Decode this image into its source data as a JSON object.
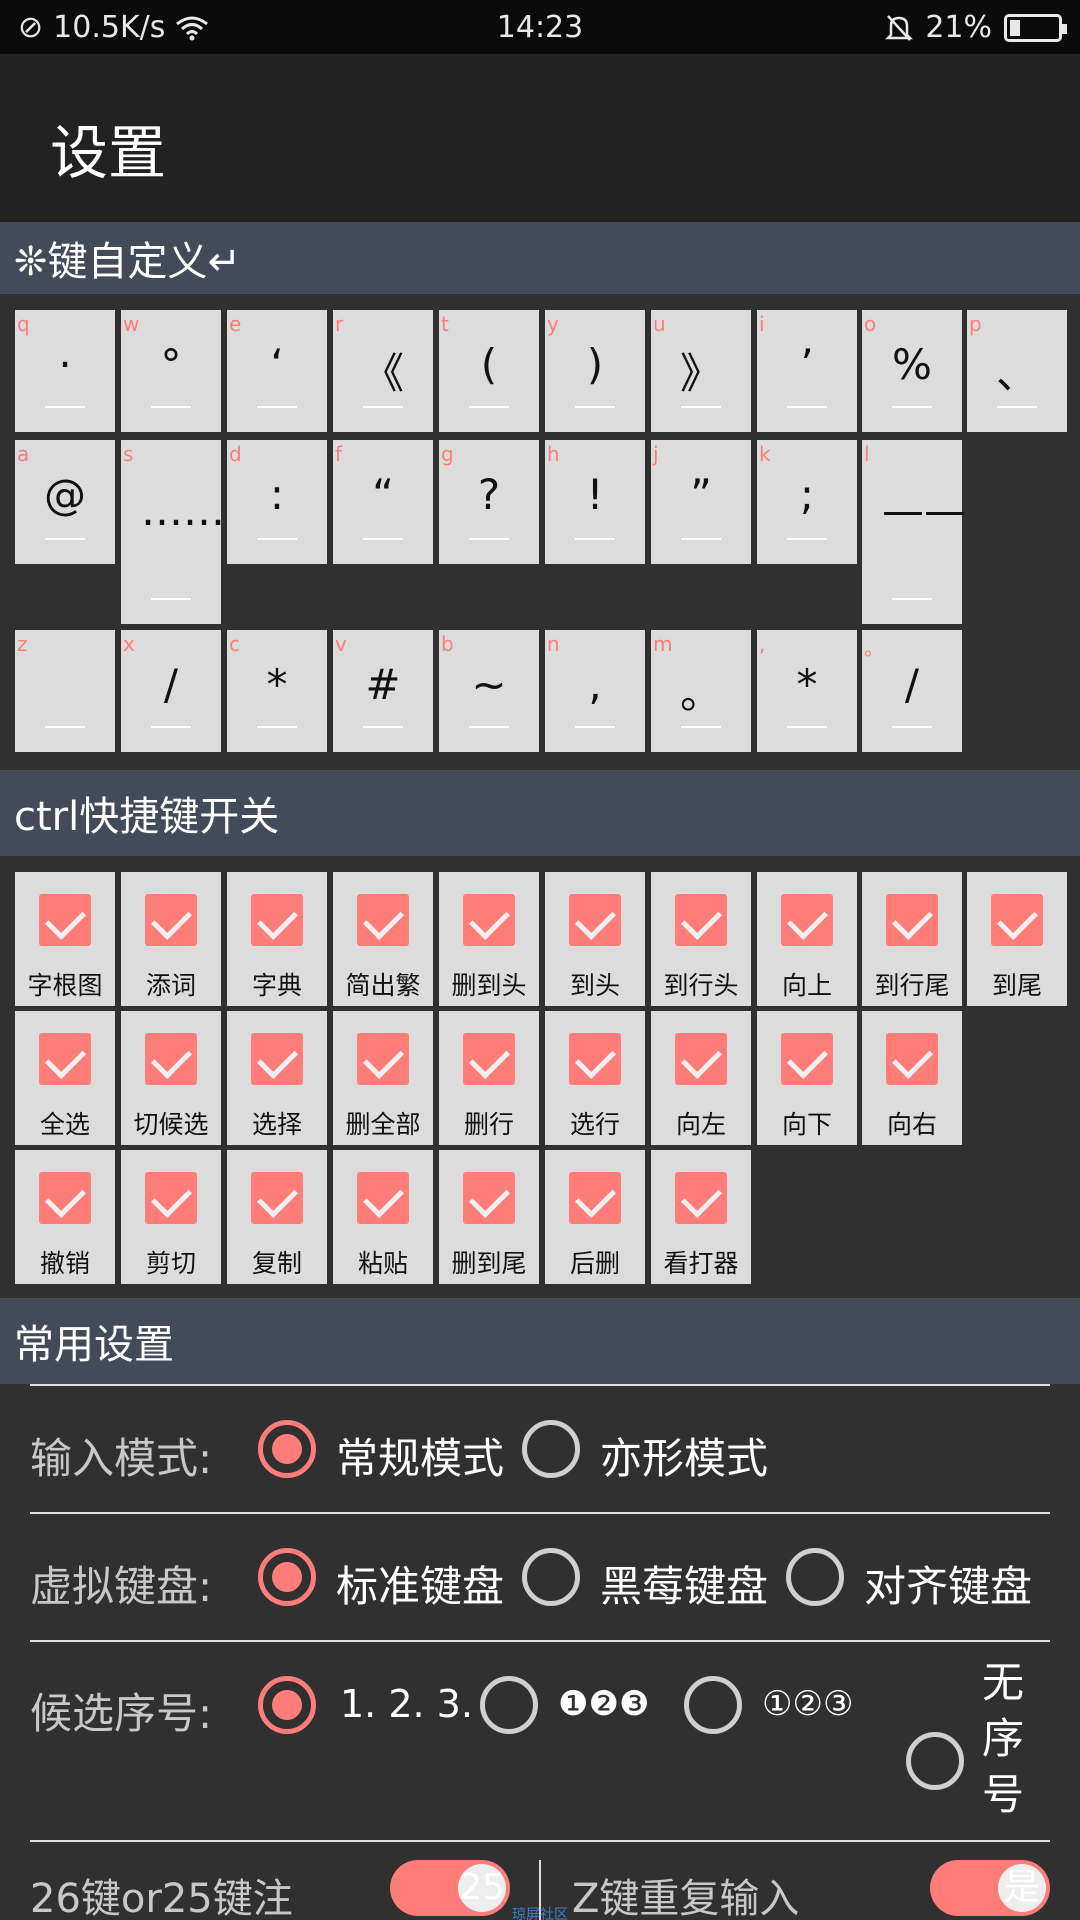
{
  "status": {
    "speed": "10.5K/s",
    "time": "14:23",
    "battery": "21%",
    "battery_level": 0.21
  },
  "app": {
    "title": "设置"
  },
  "sections": {
    "custom_keys": "❊键自定义↵",
    "ctrl": "ctrl快捷键开关",
    "common": "常用设置"
  },
  "keys": [
    {
      "l": "q",
      "s": "·"
    },
    {
      "l": "w",
      "s": "°"
    },
    {
      "l": "e",
      "s": "‘"
    },
    {
      "l": "r",
      "s": "《"
    },
    {
      "l": "t",
      "s": "("
    },
    {
      "l": "y",
      "s": ")"
    },
    {
      "l": "u",
      "s": "》"
    },
    {
      "l": "i",
      "s": "’"
    },
    {
      "l": "o",
      "s": "%"
    },
    {
      "l": "p",
      "s": "、"
    },
    {
      "l": "a",
      "s": "@"
    },
    {
      "l": "s",
      "s": "……"
    },
    {
      "l": "d",
      "s": ":"
    },
    {
      "l": "f",
      "s": "“"
    },
    {
      "l": "g",
      "s": "?"
    },
    {
      "l": "h",
      "s": "!"
    },
    {
      "l": "j",
      "s": "”"
    },
    {
      "l": "k",
      "s": ";"
    },
    {
      "l": "l",
      "s": "——"
    },
    {
      "l": "z",
      "s": ""
    },
    {
      "l": "x",
      "s": "/"
    },
    {
      "l": "c",
      "s": "*"
    },
    {
      "l": "v",
      "s": "#"
    },
    {
      "l": "b",
      "s": "~"
    },
    {
      "l": "n",
      "s": ","
    },
    {
      "l": "m",
      "s": "。"
    },
    {
      "l": ",",
      "s": "*"
    },
    {
      "l": "。",
      "s": "/"
    }
  ],
  "ctrl_toggles": [
    {
      "label": "字根图",
      "checked": true
    },
    {
      "label": "添词",
      "checked": true
    },
    {
      "label": "字典",
      "checked": true
    },
    {
      "label": "简出繁",
      "checked": true
    },
    {
      "label": "删到头",
      "checked": true
    },
    {
      "label": "到头",
      "checked": true
    },
    {
      "label": "到行头",
      "checked": true
    },
    {
      "label": "向上",
      "checked": true
    },
    {
      "label": "到行尾",
      "checked": true
    },
    {
      "label": "到尾",
      "checked": true
    },
    {
      "label": "全选",
      "checked": true
    },
    {
      "label": "切候选",
      "checked": true
    },
    {
      "label": "选择",
      "checked": true
    },
    {
      "label": "删全部",
      "checked": true
    },
    {
      "label": "删行",
      "checked": true
    },
    {
      "label": "选行",
      "checked": true
    },
    {
      "label": "向左",
      "checked": true
    },
    {
      "label": "向下",
      "checked": true
    },
    {
      "label": "向右",
      "checked": true
    },
    {
      "label": "撤销",
      "checked": true
    },
    {
      "label": "剪切",
      "checked": true
    },
    {
      "label": "复制",
      "checked": true
    },
    {
      "label": "粘贴",
      "checked": true
    },
    {
      "label": "删到尾",
      "checked": true
    },
    {
      "label": "后删",
      "checked": true
    },
    {
      "label": "看打器",
      "checked": true
    }
  ],
  "settings": {
    "input_mode": {
      "label": "输入模式:",
      "options": [
        "常规模式",
        "亦形模式"
      ],
      "selected": 0
    },
    "keyboard": {
      "label": "虚拟键盘:",
      "options": [
        "标准键盘",
        "黑莓键盘",
        "对齐键盘"
      ],
      "selected": 0
    },
    "candidate_index": {
      "label": "候选序号:",
      "options": [
        "1. 2. 3.",
        "❶❷❸",
        "①②③",
        "无序号"
      ],
      "selected": 0
    },
    "key_mode": {
      "label": "26键or25键注",
      "switch_text": "25",
      "on": true
    },
    "z_repeat": {
      "label": "Z键重复输入",
      "switch_text": "是",
      "on": true
    }
  },
  "colors": {
    "accent": "#ff7d78",
    "section": "#434b5a",
    "appbar": "#222222",
    "background": "#303030"
  },
  "watermark": "琼屏社区"
}
